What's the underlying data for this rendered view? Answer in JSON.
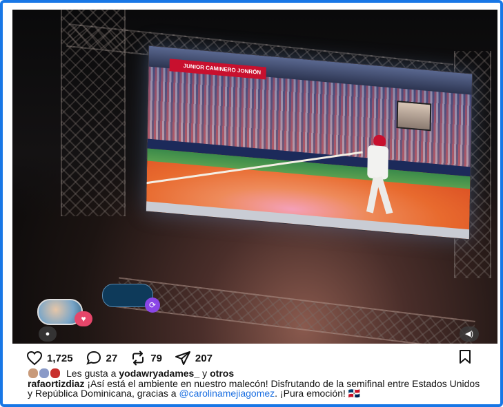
{
  "post": {
    "screen_banner": "JUNIOR CAMINERO  JONRÓN",
    "actions": {
      "likes_count": "1,725",
      "comments_count": "27",
      "reposts_count": "79",
      "shares_count": "207"
    },
    "liked_by": {
      "prefix": "Les gusta a",
      "user": "yodawryadames_",
      "connector": "y",
      "others": "otros"
    },
    "caption": {
      "author": "rafaortizdiaz",
      "text_part1": "¡Así está el ambiente en nuestro malecón! Disfrutando de la semifinal entre Estados Unidos y República Dominicana, gracias a",
      "mention": "@carolinamejiagomez",
      "text_part2": ". ¡Pura emoción! 🇩🇴"
    }
  },
  "icons": {
    "heart": "heart-icon",
    "comment": "comment-icon",
    "repost": "repost-icon",
    "share": "share-icon",
    "save": "bookmark-icon",
    "profile": "person-icon",
    "sound": "speaker-icon"
  },
  "colors": {
    "frame_border": "#1877e6",
    "mention": "#1a6ee0",
    "heart_badge": "#e6466a",
    "repost_badge": "#8a46e6"
  }
}
